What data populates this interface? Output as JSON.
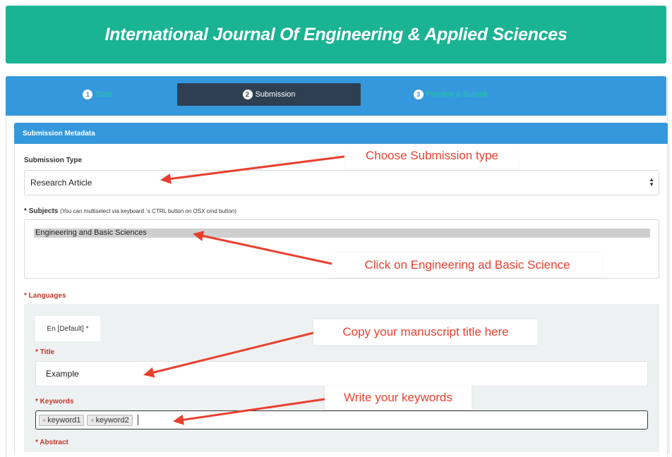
{
  "header": {
    "title": "International Journal Of Engineering & Applied Sciences"
  },
  "steps": [
    {
      "num": "1",
      "label": "Start"
    },
    {
      "num": "2",
      "label": "Submission"
    },
    {
      "num": "3",
      "label": "Preview & Submit"
    }
  ],
  "panel": {
    "title": "Submission Metadata"
  },
  "form": {
    "submission_type_label": "Submission Type",
    "submission_type_value": "Research Article",
    "subjects_req": "*",
    "subjects_label": "Subjects",
    "subjects_hint": "(You can multiselect via keyboard `s CTRL button on OSX cmd button)",
    "subjects_option": "Engineering and Basic Sciences",
    "languages_label": "* Languages",
    "language_tab": "En [Default] *",
    "title_label": "* Title",
    "title_value": "Example",
    "keywords_label": "* Keywords",
    "keywords": [
      "keyword1",
      "keyword2"
    ],
    "abstract_label": "* Abstract"
  },
  "annotations": {
    "submission_type": "Choose Submission type",
    "subjects": "Click on Engineering ad Basic Science",
    "title": "Copy your manuscript title here",
    "keywords": "Write your keywords"
  },
  "colors": {
    "header_bg": "#1ab394",
    "step_bar": "#3598dc",
    "active_step": "#2f3f52",
    "required": "#c0392b",
    "annotation": "#e8402f"
  },
  "icons": {
    "select_arrows": "updown-arrows-icon",
    "tag_remove": "x-icon"
  }
}
